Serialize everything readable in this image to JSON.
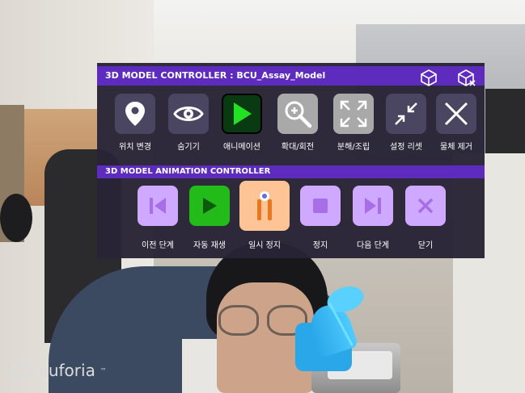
{
  "controller": {
    "title": "3D MODEL CONTROLLER : BCU_Assay_Model",
    "header_icons": [
      {
        "name": "cube-icon"
      },
      {
        "name": "cube-remove-icon"
      }
    ],
    "buttons": [
      {
        "label": "위치 변경",
        "icon": "location-pin-icon",
        "bg": "#4a4560"
      },
      {
        "label": "숨기기",
        "icon": "eye-icon",
        "bg": "#4a4560"
      },
      {
        "label": "애니메이션",
        "icon": "play-icon",
        "bg": "#0a3a12",
        "accent": "#22e022"
      },
      {
        "label": "확대/회전",
        "icon": "zoom-in-icon",
        "bg": "#a9a9a9"
      },
      {
        "label": "분해/조립",
        "icon": "expand-arrows-icon",
        "bg": "#a9a9a9"
      },
      {
        "label": "설정 리셋",
        "icon": "compress-arrows-icon",
        "bg": "#4a4560"
      },
      {
        "label": "물체 제거",
        "icon": "close-icon",
        "bg": "#4a4560"
      }
    ]
  },
  "animation_controller": {
    "title": "3D MODEL ANIMATION CONTROLLER",
    "buttons": [
      {
        "label": "이전 단계",
        "icon": "skip-back-icon",
        "bg": "#cfa8ff"
      },
      {
        "label": "자동 재생",
        "icon": "play-icon",
        "bg": "#22bb1a"
      },
      {
        "label": "일시 정지",
        "icon": "pause-icon",
        "bg": "#ffc496"
      },
      {
        "label": "정지",
        "icon": "stop-icon",
        "bg": "#cfa8ff"
      },
      {
        "label": "다음 단계",
        "icon": "skip-forward-icon",
        "bg": "#cfa8ff"
      },
      {
        "label": "닫기",
        "icon": "close-icon",
        "bg": "#cfa8ff"
      }
    ]
  },
  "watermark": "vuforia"
}
